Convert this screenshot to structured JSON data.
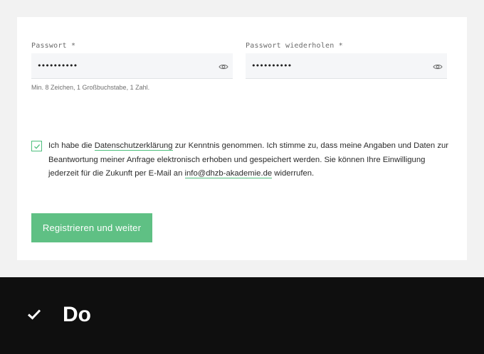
{
  "form": {
    "password": {
      "label": "Passwort *",
      "value": "••••••••••",
      "hint": "Min. 8 Zeichen, 1 Großbuchstabe, 1 Zahl."
    },
    "password_repeat": {
      "label": "Passwort wiederholen *",
      "value": "••••••••••"
    },
    "consent": {
      "checked": true,
      "text_1": "Ich habe die ",
      "privacy_link": "Datenschutzerklärung",
      "text_2": " zur Kenntnis genommen. Ich stimme zu, dass meine Angaben und Daten zur Beantwortung meiner Anfrage elektronisch erhoben und gespeichert werden. Sie können Ihre Einwilligung jederzeit für die Zukunft per E-Mail an ",
      "email_link": "info@dhzb-akademie.de",
      "text_3": " widerrufen."
    },
    "submit_label": "Registrieren und weiter"
  },
  "footer": {
    "label": "Do",
    "icon": "checkmark-icon"
  },
  "colors": {
    "accent": "#5fc084",
    "checkbox_border": "#4fbf7e",
    "footer_bg": "#0f0f0f"
  }
}
